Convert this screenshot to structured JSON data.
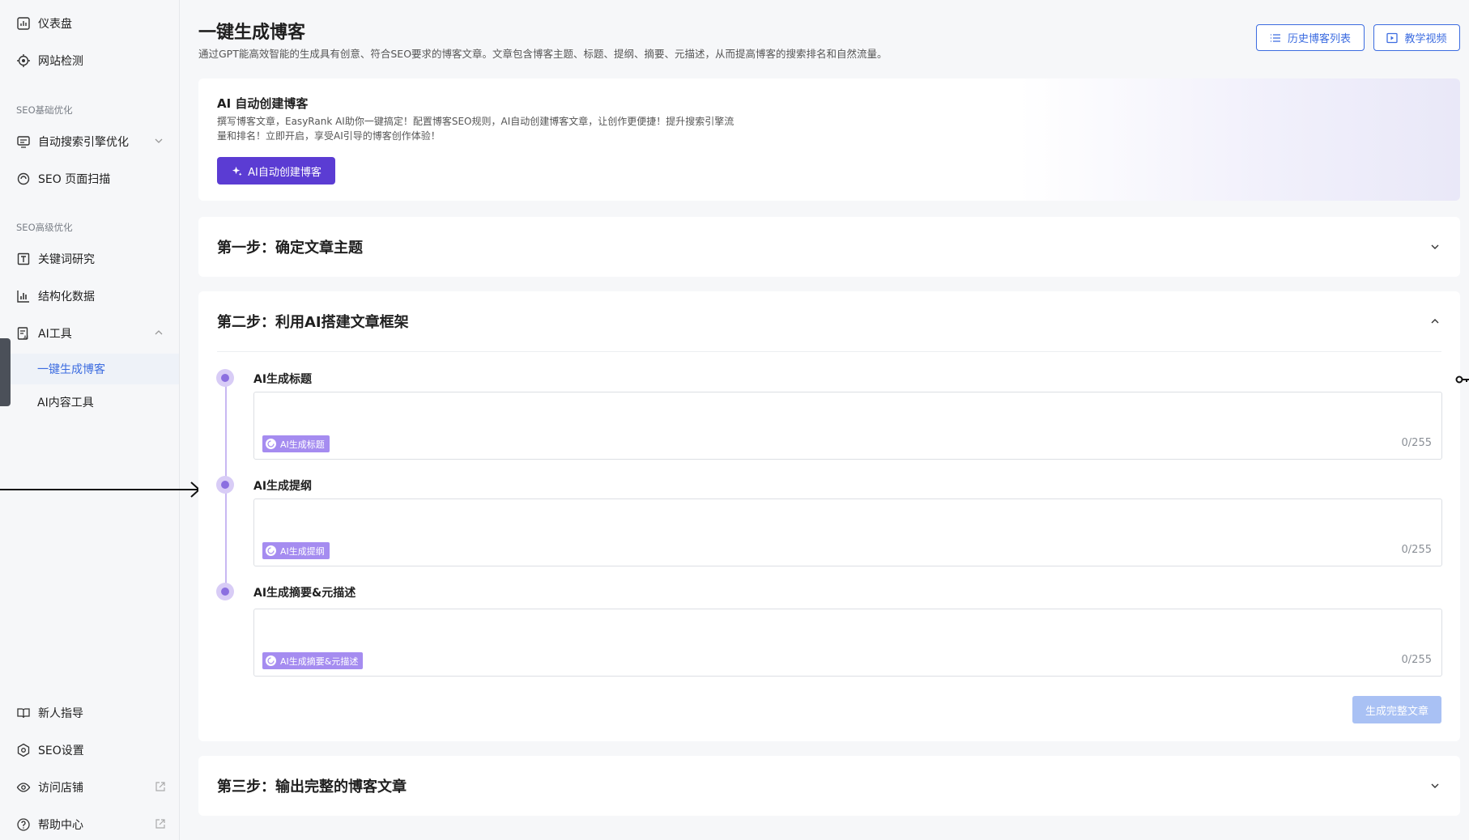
{
  "sidebar": {
    "items_top": [
      {
        "label": "仪表盘",
        "icon": "dashboard-icon"
      },
      {
        "label": "网站检测",
        "icon": "target-icon"
      }
    ],
    "section_basic": "SEO基础优化",
    "basic_items": [
      {
        "label": "自动搜索引擎优化",
        "icon": "monitor-icon"
      },
      {
        "label": "SEO 页面扫描",
        "icon": "scan-icon"
      }
    ],
    "section_advanced": "SEO高级优化",
    "advanced_items": [
      {
        "label": "关键词研究",
        "icon": "text-box-icon"
      },
      {
        "label": "结构化数据",
        "icon": "bar-chart-icon"
      },
      {
        "label": "AI工具",
        "icon": "ai-doc-icon"
      }
    ],
    "ai_sub_items": [
      {
        "label": "一键生成博客",
        "active": true
      },
      {
        "label": "AI内容工具",
        "active": false
      }
    ],
    "bottom_items": [
      {
        "label": "新人指导",
        "icon": "book-icon"
      },
      {
        "label": "SEO设置",
        "icon": "hex-gear-icon"
      },
      {
        "label": "访问店铺",
        "icon": "eye-icon"
      },
      {
        "label": "帮助中心",
        "icon": "help-icon"
      }
    ]
  },
  "header": {
    "title": "一键生成博客",
    "description": "通过GPT能高效智能的生成具有创意、符合SEO要求的博客文章。文章包含博客主题、标题、提纲、摘要、元描述，从而提高博客的搜索排名和自然流量。",
    "history_button": "历史博客列表",
    "tutorial_button": "教学视频"
  },
  "hero": {
    "title": "AI 自动创建博客",
    "description": "撰写博客文章，EasyRank AI助你一键搞定！配置博客SEO规则，AI自动创建博客文章，让创作更便捷！提升搜索引擎流量和排名！立即开启，享受AI引导的博客创作体验！",
    "button": "AI自动创建博客"
  },
  "steps": {
    "step1": "第一步：确定文章主题",
    "step2": "第二步：利用AI搭建文章框架",
    "step3": "第三步：输出完整的博客文章"
  },
  "fields": [
    {
      "label": "AI生成标题",
      "chip": "AI生成标题",
      "counter": "0/255"
    },
    {
      "label": "AI生成提纲",
      "chip": "AI生成提纲",
      "counter": "0/255"
    },
    {
      "label": "AI生成摘要&元描述",
      "chip": "AI生成摘要&元描述",
      "counter": "0/255"
    }
  ],
  "complete_button": "生成完整文章",
  "colors": {
    "primary": "#3c6ce0",
    "purple": "#5b3cd3",
    "chip": "#a58cf0",
    "disabled_button": "#a9c1f4"
  }
}
